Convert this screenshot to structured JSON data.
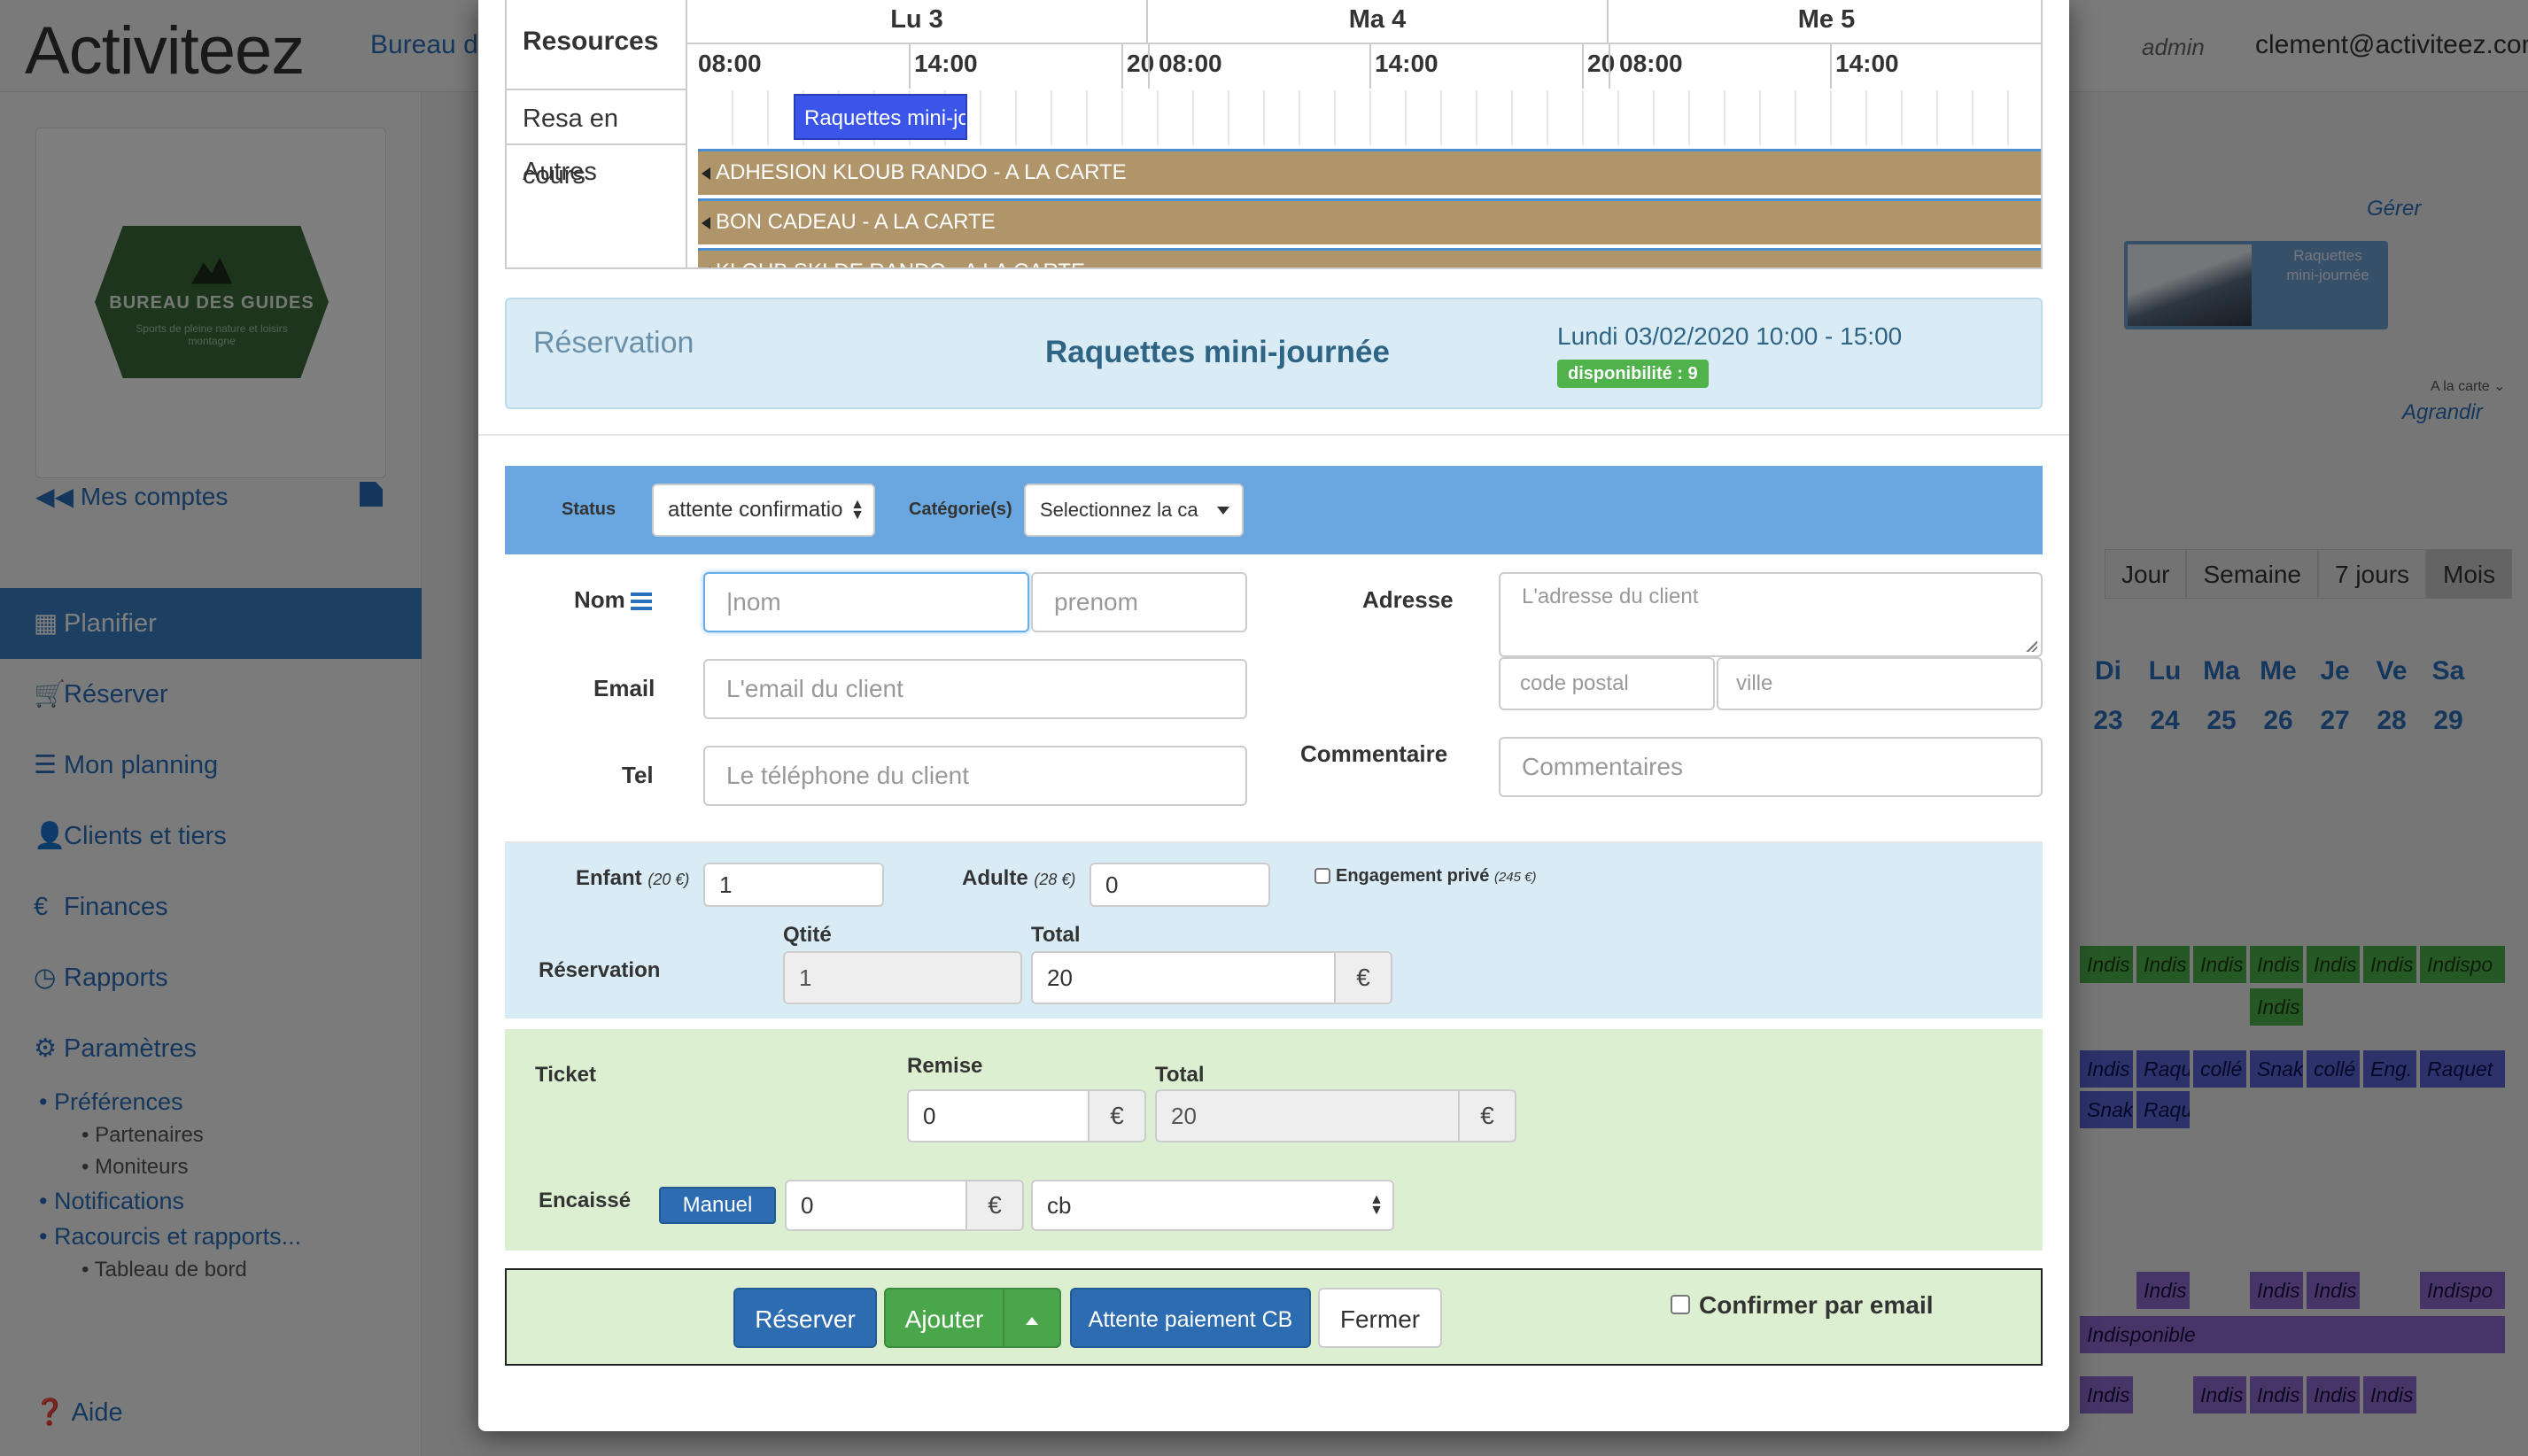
{
  "header": {
    "brand": "Activiteez",
    "bureau_link": "Bureau de",
    "admin": "admin",
    "email": "clement@activiteez.com"
  },
  "sidebar": {
    "logo_text": "BUREAU DES GUIDES",
    "logo_subtext": "Sports de pleine nature et loisirs montagne",
    "mes_comptes": "Mes comptes",
    "menu": [
      {
        "icon": "calendar-icon",
        "glyph": "▦",
        "label": "Planifier",
        "active": true
      },
      {
        "icon": "cart-icon",
        "glyph": "🛒",
        "label": "Réserver"
      },
      {
        "icon": "list-icon",
        "glyph": "☰",
        "label": "Mon planning"
      },
      {
        "icon": "user-icon",
        "glyph": "👤",
        "label": "Clients et tiers"
      },
      {
        "icon": "euro-icon",
        "glyph": "€",
        "label": "Finances"
      },
      {
        "icon": "clock-icon",
        "glyph": "◷",
        "label": "Rapports"
      },
      {
        "icon": "gear-icon",
        "glyph": "⚙",
        "label": "Paramètres"
      }
    ],
    "submenu": {
      "preferences": "Préférences",
      "partenaires": "Partenaires",
      "moniteurs": "Moniteurs",
      "notifications": "Notifications",
      "raccourcis": "Racourcis et rapports...",
      "tableau": "Tableau de bord"
    },
    "aide": "Aide"
  },
  "background": {
    "thumb_caption": "Raquettes mini-journée",
    "gerer": "Gérer",
    "alacarte": "A la carte",
    "agrandir": "Agrandir",
    "views": [
      "Jour",
      "Semaine",
      "7 jours",
      "Mois"
    ],
    "active_view": "Mois",
    "days": [
      {
        "d": "Di",
        "n": "23"
      },
      {
        "d": "Lu",
        "n": "24"
      },
      {
        "d": "Ma",
        "n": "25"
      },
      {
        "d": "Me",
        "n": "26"
      },
      {
        "d": "Je",
        "n": "27"
      },
      {
        "d": "Ve",
        "n": "28"
      },
      {
        "d": "Sa",
        "n": "29"
      }
    ],
    "chips": {
      "indis": "Indis",
      "indispo": "Indispo",
      "raqu": "Raqu",
      "colle": "collé",
      "snak": "Snak",
      "eng": "Eng.",
      "raquet": "Raquet",
      "indisponible": "Indisponible"
    }
  },
  "grid": {
    "resources_label": "Resources",
    "days": [
      "Lu 3",
      "Ma 4",
      "Me 5"
    ],
    "times": [
      "08:00",
      "14:00",
      "20"
    ],
    "row_resa": "Resa en cours",
    "row_autres": "Autres",
    "resa_chip": "Raquettes mini-jo",
    "bars": [
      "ADHESION KLOUB RANDO - A LA CARTE",
      "BON CADEAU - A LA CARTE",
      "KLOUB SKI DE RANDO - A LA CARTE"
    ]
  },
  "reservation": {
    "label": "Réservation",
    "activity": "Raquettes mini-journée",
    "date": "Lundi 03/02/2020 10:00 - 15:00",
    "dispo": "disponibilité : 9"
  },
  "status": {
    "status_label": "Status",
    "status_value": "attente confirmatio",
    "categories_label": "Catégorie(s)",
    "categories_value": "Selectionnez la ca"
  },
  "client": {
    "nom_label": "Nom",
    "nom_placeholder": "nom",
    "prenom_placeholder": "prenom",
    "email_label": "Email",
    "email_placeholder": "L'email du client",
    "tel_label": "Tel",
    "tel_placeholder": "Le téléphone du client",
    "adresse_label": "Adresse",
    "adresse_placeholder": "L'adresse du client",
    "cp_placeholder": "code postal",
    "ville_placeholder": "ville",
    "commentaire_label": "Commentaire",
    "commentaire_placeholder": "Commentaires"
  },
  "tarifs": {
    "enfant_label": "Enfant",
    "enfant_price": "(20 €)",
    "enfant_value": "1",
    "adulte_label": "Adulte",
    "adulte_price": "(28 €)",
    "adulte_value": "0",
    "engagement_label": "Engagement privé",
    "engagement_price": "(245 €)",
    "qtite_label": "Qtité",
    "total_label": "Total",
    "reservation_label": "Réservation",
    "qtite_value": "1",
    "total_value": "20",
    "currency": "€"
  },
  "ticket": {
    "ticket_label": "Ticket",
    "remise_label": "Remise",
    "total_label": "Total",
    "remise_value": "0",
    "total_value": "20",
    "encaisse_label": "Encaissé",
    "manuel_label": "Manuel",
    "encaisse_value": "0",
    "payment_method": "cb",
    "currency": "€"
  },
  "footer": {
    "reserver": "Réserver",
    "ajouter": "Ajouter",
    "attente": "Attente paiement CB",
    "fermer": "Fermer",
    "confirmer": "Confirmer par email"
  },
  "colors": {
    "primary": "#2d6cb0",
    "success": "#4aa64a",
    "resa_chip": "#3b55e8",
    "bar_tan": "#b0946a",
    "status_strip": "#6aa7e0",
    "panel_blue": "#d9ecf6",
    "panel_green": "#dcefd0"
  }
}
